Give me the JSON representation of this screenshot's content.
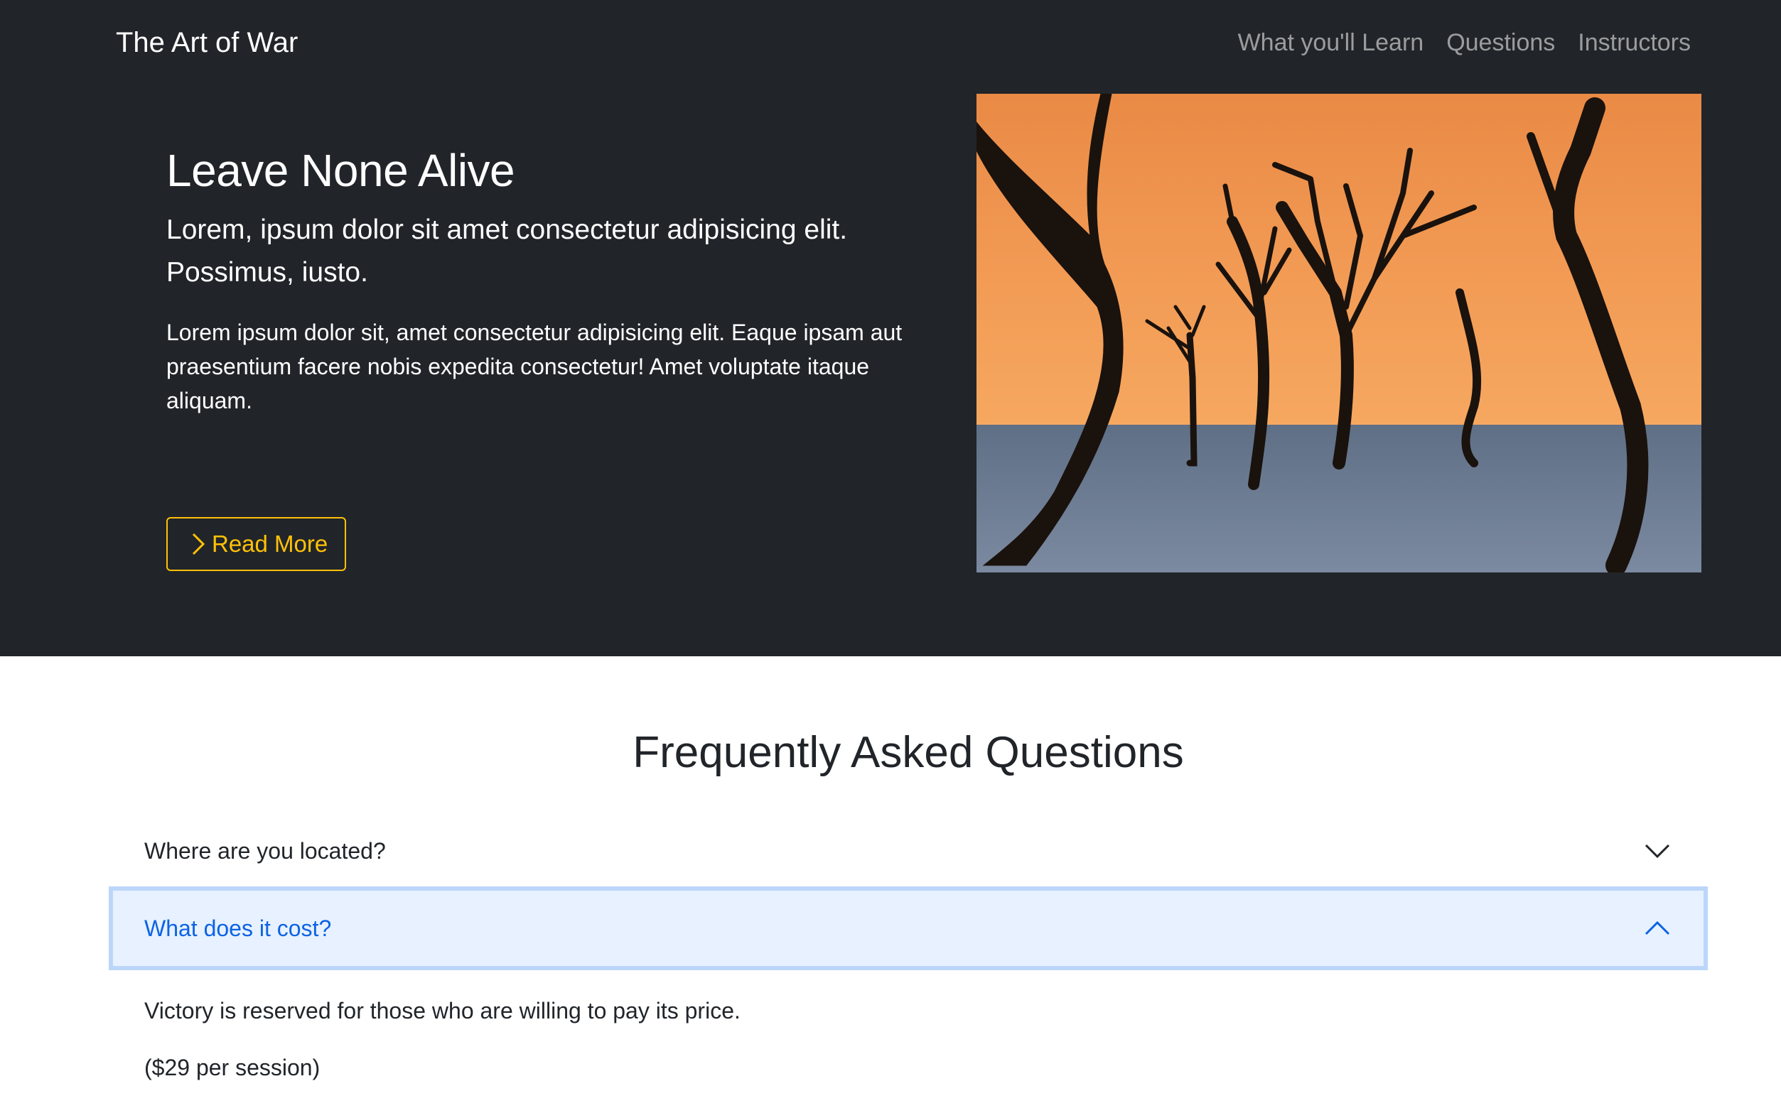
{
  "nav": {
    "brand": "The Art of War",
    "links": [
      "What you'll Learn",
      "Questions",
      "Instructors"
    ]
  },
  "hero": {
    "title": "Leave None Alive",
    "lead": "Lorem, ipsum dolor sit amet consectetur adipisicing elit. Possimus, iusto.",
    "body": "Lorem ipsum dolor sit, amet consectetur adipisicing elit. Eaque ipsam aut praesentium facere nobis expedita consectetur! Amet voluptate itaque aliquam.",
    "button_label": "Read More",
    "button_icon": "chevron-right-icon",
    "image": "desert-dead-trees-photo"
  },
  "faq": {
    "title": "Frequently Asked Questions",
    "items": [
      {
        "question": "Where are you located?",
        "expanded": false,
        "icon": "chevron-down-icon"
      },
      {
        "question": "What does it cost?",
        "expanded": true,
        "icon": "chevron-up-icon",
        "answer": [
          "Victory is reserved for those who are willing to pay its price.",
          "($29 per session)"
        ]
      }
    ]
  },
  "colors": {
    "dark_bg": "#212529",
    "accent_warning": "#ffc107",
    "accordion_active_bg": "#e7f1ff",
    "accordion_active_text": "#0c63e4"
  }
}
